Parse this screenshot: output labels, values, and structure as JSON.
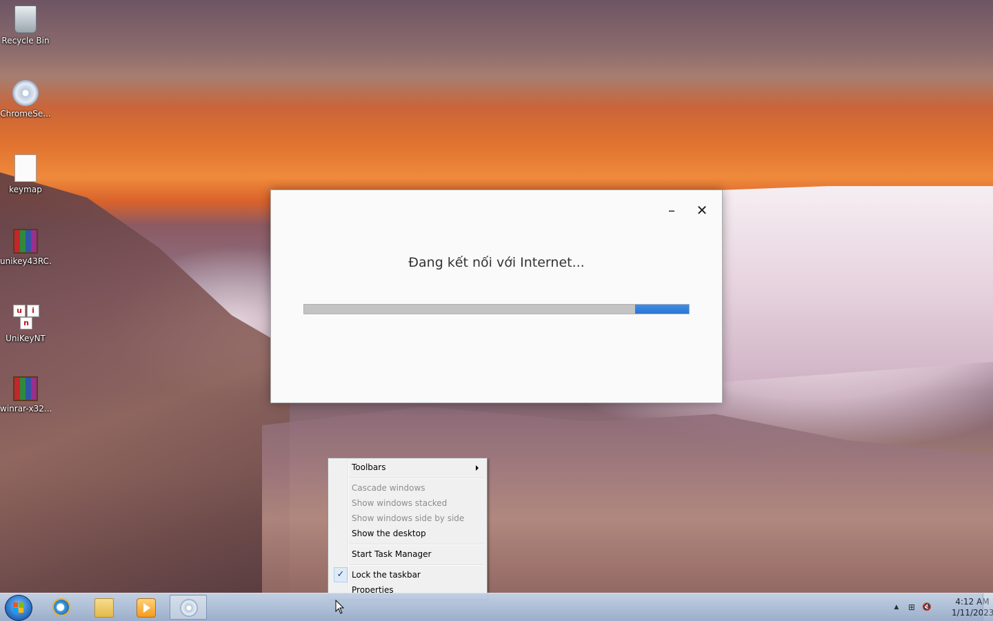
{
  "desktop": {
    "icons": [
      {
        "label": "Recycle Bin"
      },
      {
        "label": "ChromeSe..."
      },
      {
        "label": "keymap"
      },
      {
        "label": "unikey43RC..."
      },
      {
        "label": "UniKeyNT"
      },
      {
        "label": "winrar-x32..."
      }
    ]
  },
  "dialog": {
    "message": "Đang kết nối với Internet...",
    "minimize_glyph": "–",
    "close_glyph": "✕",
    "progress": {
      "chunk_start": 0.86,
      "chunk_end": 1.0,
      "color": "#2f7fdc"
    }
  },
  "context_menu": {
    "items": [
      {
        "label": "Toolbars",
        "has_submenu": true
      },
      {
        "label": "Cascade windows",
        "disabled": true
      },
      {
        "label": "Show windows stacked",
        "disabled": true
      },
      {
        "label": "Show windows side by side",
        "disabled": true
      },
      {
        "label": "Show the desktop"
      },
      {
        "label": "Start Task Manager"
      },
      {
        "label": "Lock the taskbar",
        "checked": true
      },
      {
        "label": "Properties"
      }
    ],
    "check_glyph": "✓"
  },
  "taskbar": {
    "pinned": [
      {
        "name": "internet-explorer-icon"
      },
      {
        "name": "windows-explorer-icon"
      },
      {
        "name": "media-player-icon"
      },
      {
        "name": "setup-app-icon",
        "active": true
      }
    ],
    "tray": {
      "show_hidden_glyph": "▲",
      "network_glyph": "⊞",
      "volume_glyph": "🔇"
    },
    "clock": {
      "time": "4:12 AM",
      "date": "1/11/2023"
    }
  }
}
